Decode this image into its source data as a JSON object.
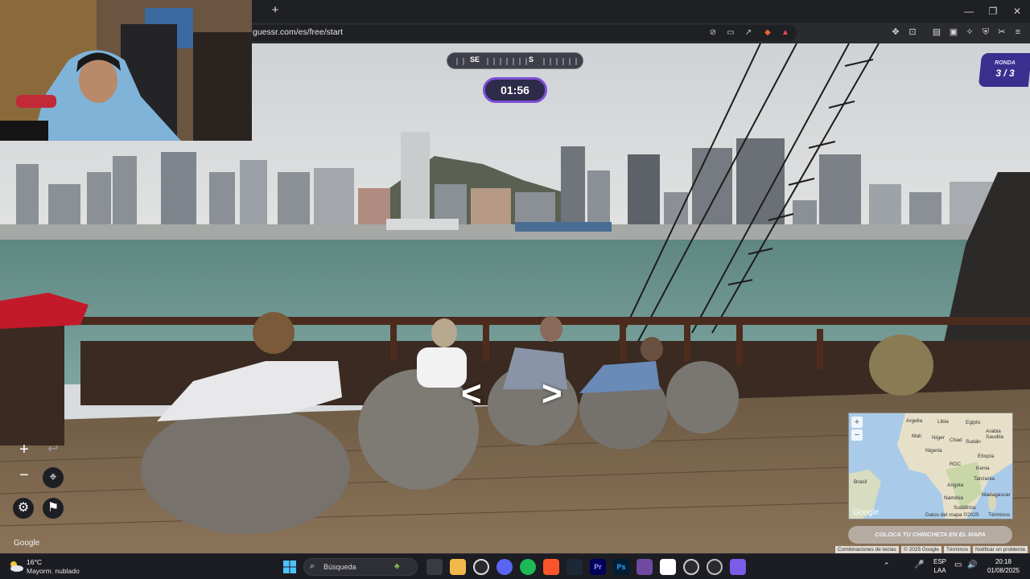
{
  "browser": {
    "url": "guessr.com/es/free/start",
    "new_tab": "+"
  },
  "game": {
    "compass": {
      "left_label": "SE",
      "right_label": "S"
    },
    "timer": "01:56",
    "round": {
      "label": "RONDA",
      "value": "3 / 3"
    },
    "nav_arrow_left": "<",
    "nav_arrow_right": ">",
    "zoom_in": "+",
    "zoom_out": "−",
    "undo": "↩",
    "google_logo": "Google"
  },
  "minimap": {
    "labels": [
      "Argelia",
      "Libia",
      "Egipto",
      "Arabia Saudita",
      "Mali",
      "Níger",
      "Chad",
      "Sudán",
      "Nigeria",
      "Etiopía",
      "RDC",
      "Kenia",
      "Tanzania",
      "Angola",
      "Namibia",
      "Madagascar",
      "Sudáfrica",
      "Brasil"
    ],
    "google": "Google",
    "footer_data": "Datos del mapa ©2025",
    "footer_terms": "Términos",
    "zoom_in": "+",
    "zoom_out": "−",
    "place_pin_button": "COLOCA TU CHINCHETA EN EL MAPA"
  },
  "attribution": {
    "shortcuts": "Combinaciones de teclas",
    "copyright": "© 2025 Google",
    "terms": "Términos",
    "report": "Notificar un problema"
  },
  "taskbar": {
    "weather_temp": "16°C",
    "weather_desc": "Mayorm. nublado",
    "search_placeholder": "Búsqueda",
    "lang": "ESP",
    "lang_sub": "LAA",
    "time": "20:18",
    "date": "01/08/2025"
  },
  "colors": {
    "timer_border": "#7b4fd6",
    "round_badge": "#3a2f8f",
    "sea": "#6f958f"
  }
}
